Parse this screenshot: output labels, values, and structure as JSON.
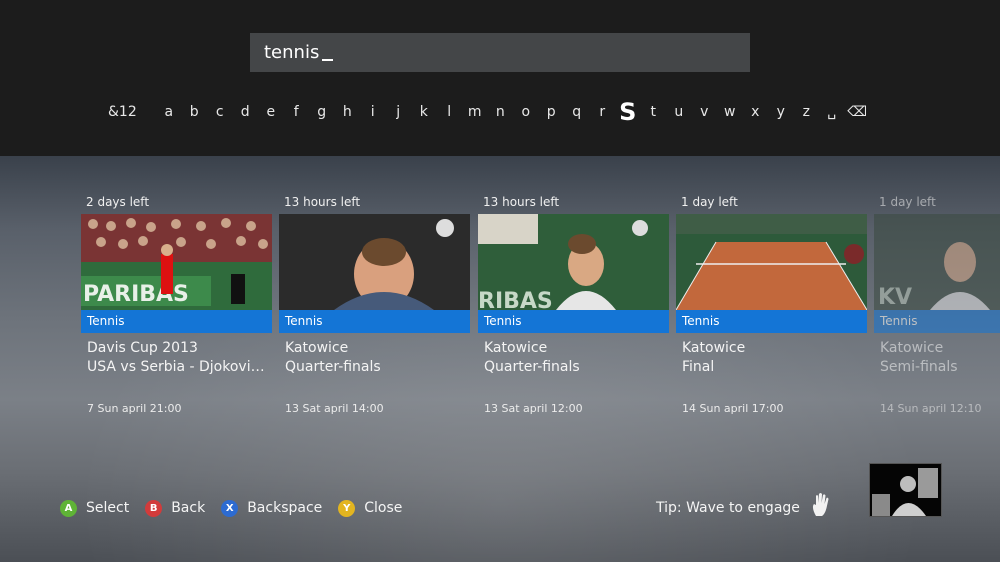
{
  "search": {
    "query": "tennis"
  },
  "keyboard": {
    "keys": [
      "&12",
      "a",
      "b",
      "c",
      "d",
      "e",
      "f",
      "g",
      "h",
      "i",
      "j",
      "k",
      "l",
      "m",
      "n",
      "o",
      "p",
      "q",
      "r",
      "S",
      "t",
      "u",
      "v",
      "w",
      "x",
      "y",
      "z",
      "␣",
      "⌫"
    ],
    "selected": "S"
  },
  "results": [
    {
      "time_left": "2 days left",
      "category": "Tennis",
      "title": "Davis Cup 2013",
      "subtitle": "USA vs Serbia - Djokovic v...",
      "date": "7 Sun april 21:00"
    },
    {
      "time_left": "13 hours left",
      "category": "Tennis",
      "title": "Katowice",
      "subtitle": "Quarter-finals",
      "date": "13 Sat april 14:00"
    },
    {
      "time_left": "13 hours left",
      "category": "Tennis",
      "title": "Katowice",
      "subtitle": "Quarter-finals",
      "date": "13 Sat april 12:00"
    },
    {
      "time_left": "1 day left",
      "category": "Tennis",
      "title": "Katowice",
      "subtitle": "Final",
      "date": "14 Sun april 17:00"
    },
    {
      "time_left": "1 day left",
      "category": "Tennis",
      "title": "Katowice",
      "subtitle": "Semi-finals",
      "date": "14 Sun april 12:10"
    }
  ],
  "thumb_text": {
    "parisbas": "PARIBAS",
    "ribas": "RIBAS",
    "kv": "KV"
  },
  "actions": [
    {
      "button": "A",
      "label": "Select",
      "color": "#5fb336"
    },
    {
      "button": "B",
      "label": "Back",
      "color": "#d23b3b"
    },
    {
      "button": "X",
      "label": "Backspace",
      "color": "#2d6bd1"
    },
    {
      "button": "Y",
      "label": "Close",
      "color": "#e3b520"
    }
  ],
  "tip": "Tip: Wave to engage",
  "icons": {
    "hand": "hand-wave-icon",
    "kinect": "kinect-camera-view"
  }
}
